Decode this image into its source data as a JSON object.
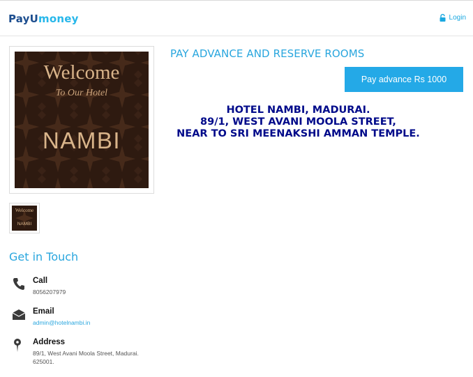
{
  "header": {
    "logo_payu": "PayU",
    "logo_money": "money",
    "login_label": "Login"
  },
  "gallery": {
    "welcome_text": "Welcome",
    "script_text": "To Our Hotel",
    "name_text": "NAMBI"
  },
  "offer": {
    "title": "PAY ADVANCE AND RESERVE ROOMS",
    "button_label": "Pay advance Rs 1000"
  },
  "hotel": {
    "line1": "HOTEL NAMBI, MADURAI.",
    "line2": "89/1, WEST AVANI MOOLA STREET,",
    "line3": "NEAR TO SRI MEENAKSHI AMMAN TEMPLE."
  },
  "contact": {
    "title": "Get in Touch",
    "call_label": "Call",
    "call_value": "8056207979",
    "email_label": "Email",
    "email_value": "admin@hotelnambi.in",
    "address_label": "Address",
    "address_value": "89/1, West Avani Moola Street, Madurai. 625001."
  },
  "icons": {
    "lock": "lock-icon",
    "phone": "phone-icon",
    "email": "envelope-icon",
    "address": "location-pin-icon"
  },
  "colors": {
    "accent": "#29a6de",
    "button": "#24a9e7",
    "brand_dark": "#1d4e8f",
    "hotel_text": "#000a8a",
    "photo_bg": "#2e1a10",
    "photo_text": "#d9b48a"
  }
}
